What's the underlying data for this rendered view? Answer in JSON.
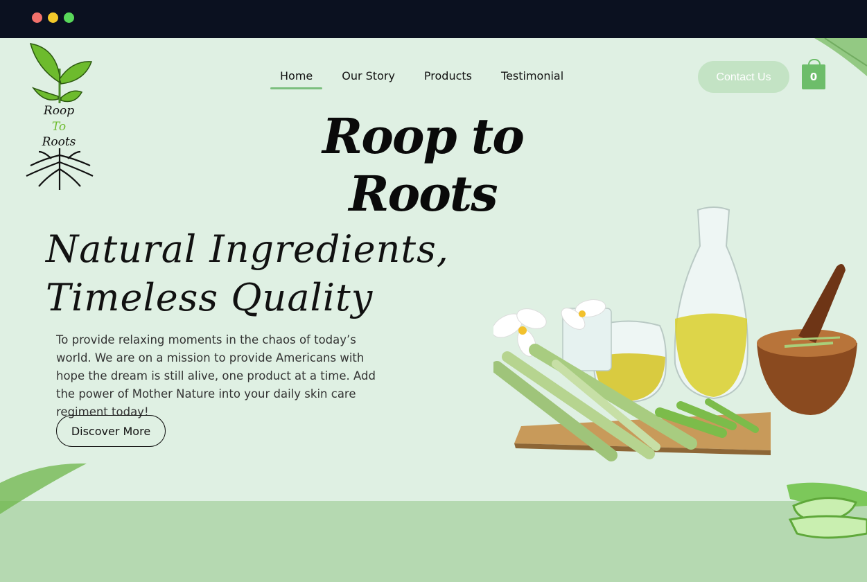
{
  "brand": {
    "logo_text": [
      "Roop",
      "To",
      "Roots"
    ],
    "title": "Roop to Roots"
  },
  "nav": {
    "items": [
      {
        "label": "Home",
        "active": true
      },
      {
        "label": "Our Story",
        "active": false
      },
      {
        "label": "Products",
        "active": false
      },
      {
        "label": "Testimonial",
        "active": false
      }
    ]
  },
  "header": {
    "contact_label": "Contact Us",
    "cart_count": "0",
    "cart_icon": "shopping-bag-icon"
  },
  "hero": {
    "headline_line1": "Natural Ingredients,",
    "headline_line2": "Timeless Quality",
    "description": "To provide relaxing moments in the chaos of today’s world. We are on a mission to provide Americans with hope the dream is still alive, one product at a time. Add the power of Mother Nature into your daily skin care regiment today!",
    "cta_label": "Discover More"
  },
  "colors": {
    "background": "#dff0e3",
    "accent": "#6dbd6a",
    "band": "#b5d9b1",
    "titlebar": "#0b1120"
  }
}
